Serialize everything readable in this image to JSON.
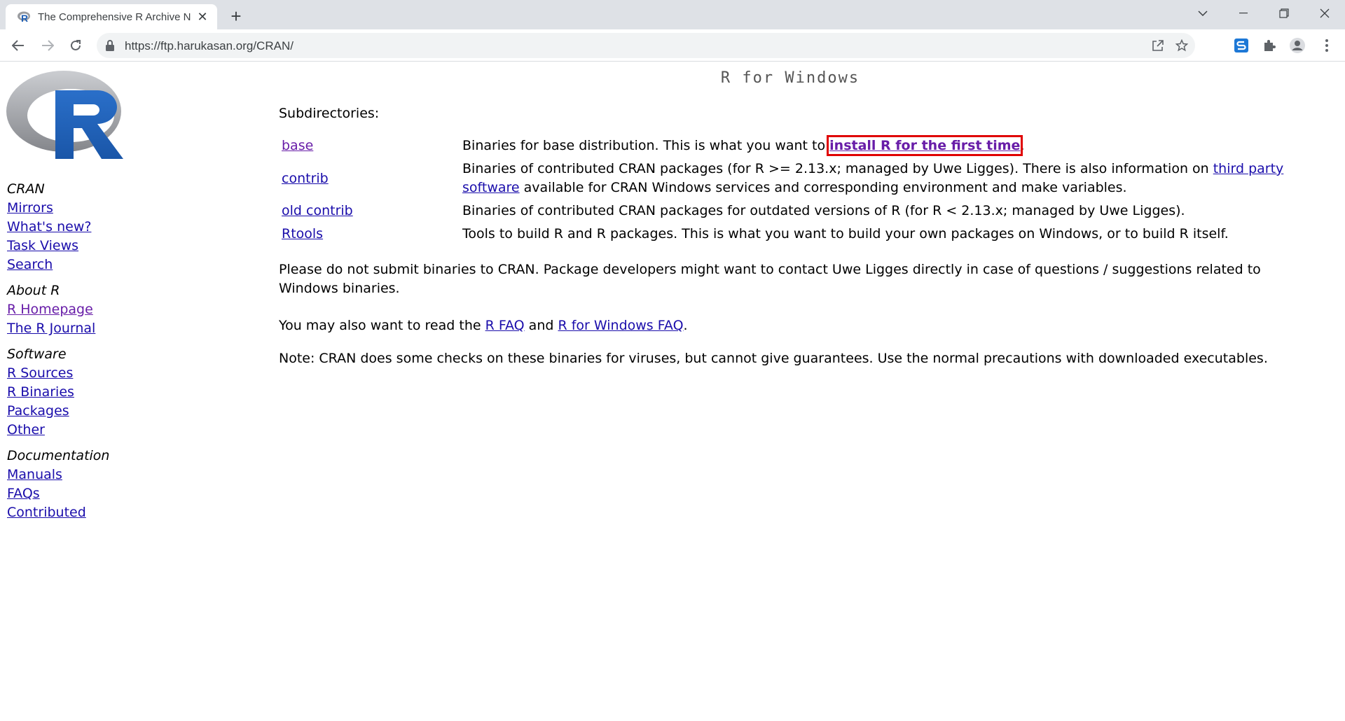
{
  "browser": {
    "tab_title": "The Comprehensive R Archive N",
    "tab_favicon": "r-logo-icon",
    "url": "https://ftp.harukasan.org/CRAN/"
  },
  "sidebar": {
    "groups": [
      {
        "heading": "CRAN",
        "links": [
          "Mirrors",
          "What's new?",
          "Task Views",
          "Search"
        ]
      },
      {
        "heading": "About R",
        "links": [
          "R Homepage",
          "The R Journal"
        ]
      },
      {
        "heading": "Software",
        "links": [
          "R Sources",
          "R Binaries",
          "Packages",
          "Other"
        ]
      },
      {
        "heading": "Documentation",
        "links": [
          "Manuals",
          "FAQs",
          "Contributed"
        ]
      }
    ]
  },
  "main": {
    "title": "R for Windows",
    "subdir_label": "Subdirectories:",
    "subdirs": [
      {
        "name": "base",
        "desc_before": "Binaries for base distribution. This is what you want to ",
        "desc_link": "install R for the first time",
        "desc_after": "."
      },
      {
        "name": "contrib",
        "desc_before": "Binaries of contributed CRAN packages (for R >= 2.13.x; managed by Uwe Ligges). There is also information on ",
        "desc_link": "third party software",
        "desc_after": " available for CRAN Windows services and corresponding environment and make variables."
      },
      {
        "name": "old contrib",
        "desc_before": "Binaries of contributed CRAN packages for outdated versions of R (for R < 2.13.x; managed by Uwe Ligges).",
        "desc_link": "",
        "desc_after": ""
      },
      {
        "name": "Rtools",
        "desc_before": "Tools to build R and R packages. This is what you want to build your own packages on Windows, or to build R itself.",
        "desc_link": "",
        "desc_after": ""
      }
    ],
    "para1": "Please do not submit binaries to CRAN. Package developers might want to contact Uwe Ligges directly in case of questions / suggestions related to Windows binaries.",
    "para2_before": "You may also want to read the ",
    "para2_link1": "R FAQ",
    "para2_mid": " and ",
    "para2_link2": "R for Windows FAQ",
    "para2_after": ".",
    "para3": "Note: CRAN does some checks on these binaries for viruses, but cannot give guarantees. Use the normal precautions with downloaded executables."
  }
}
